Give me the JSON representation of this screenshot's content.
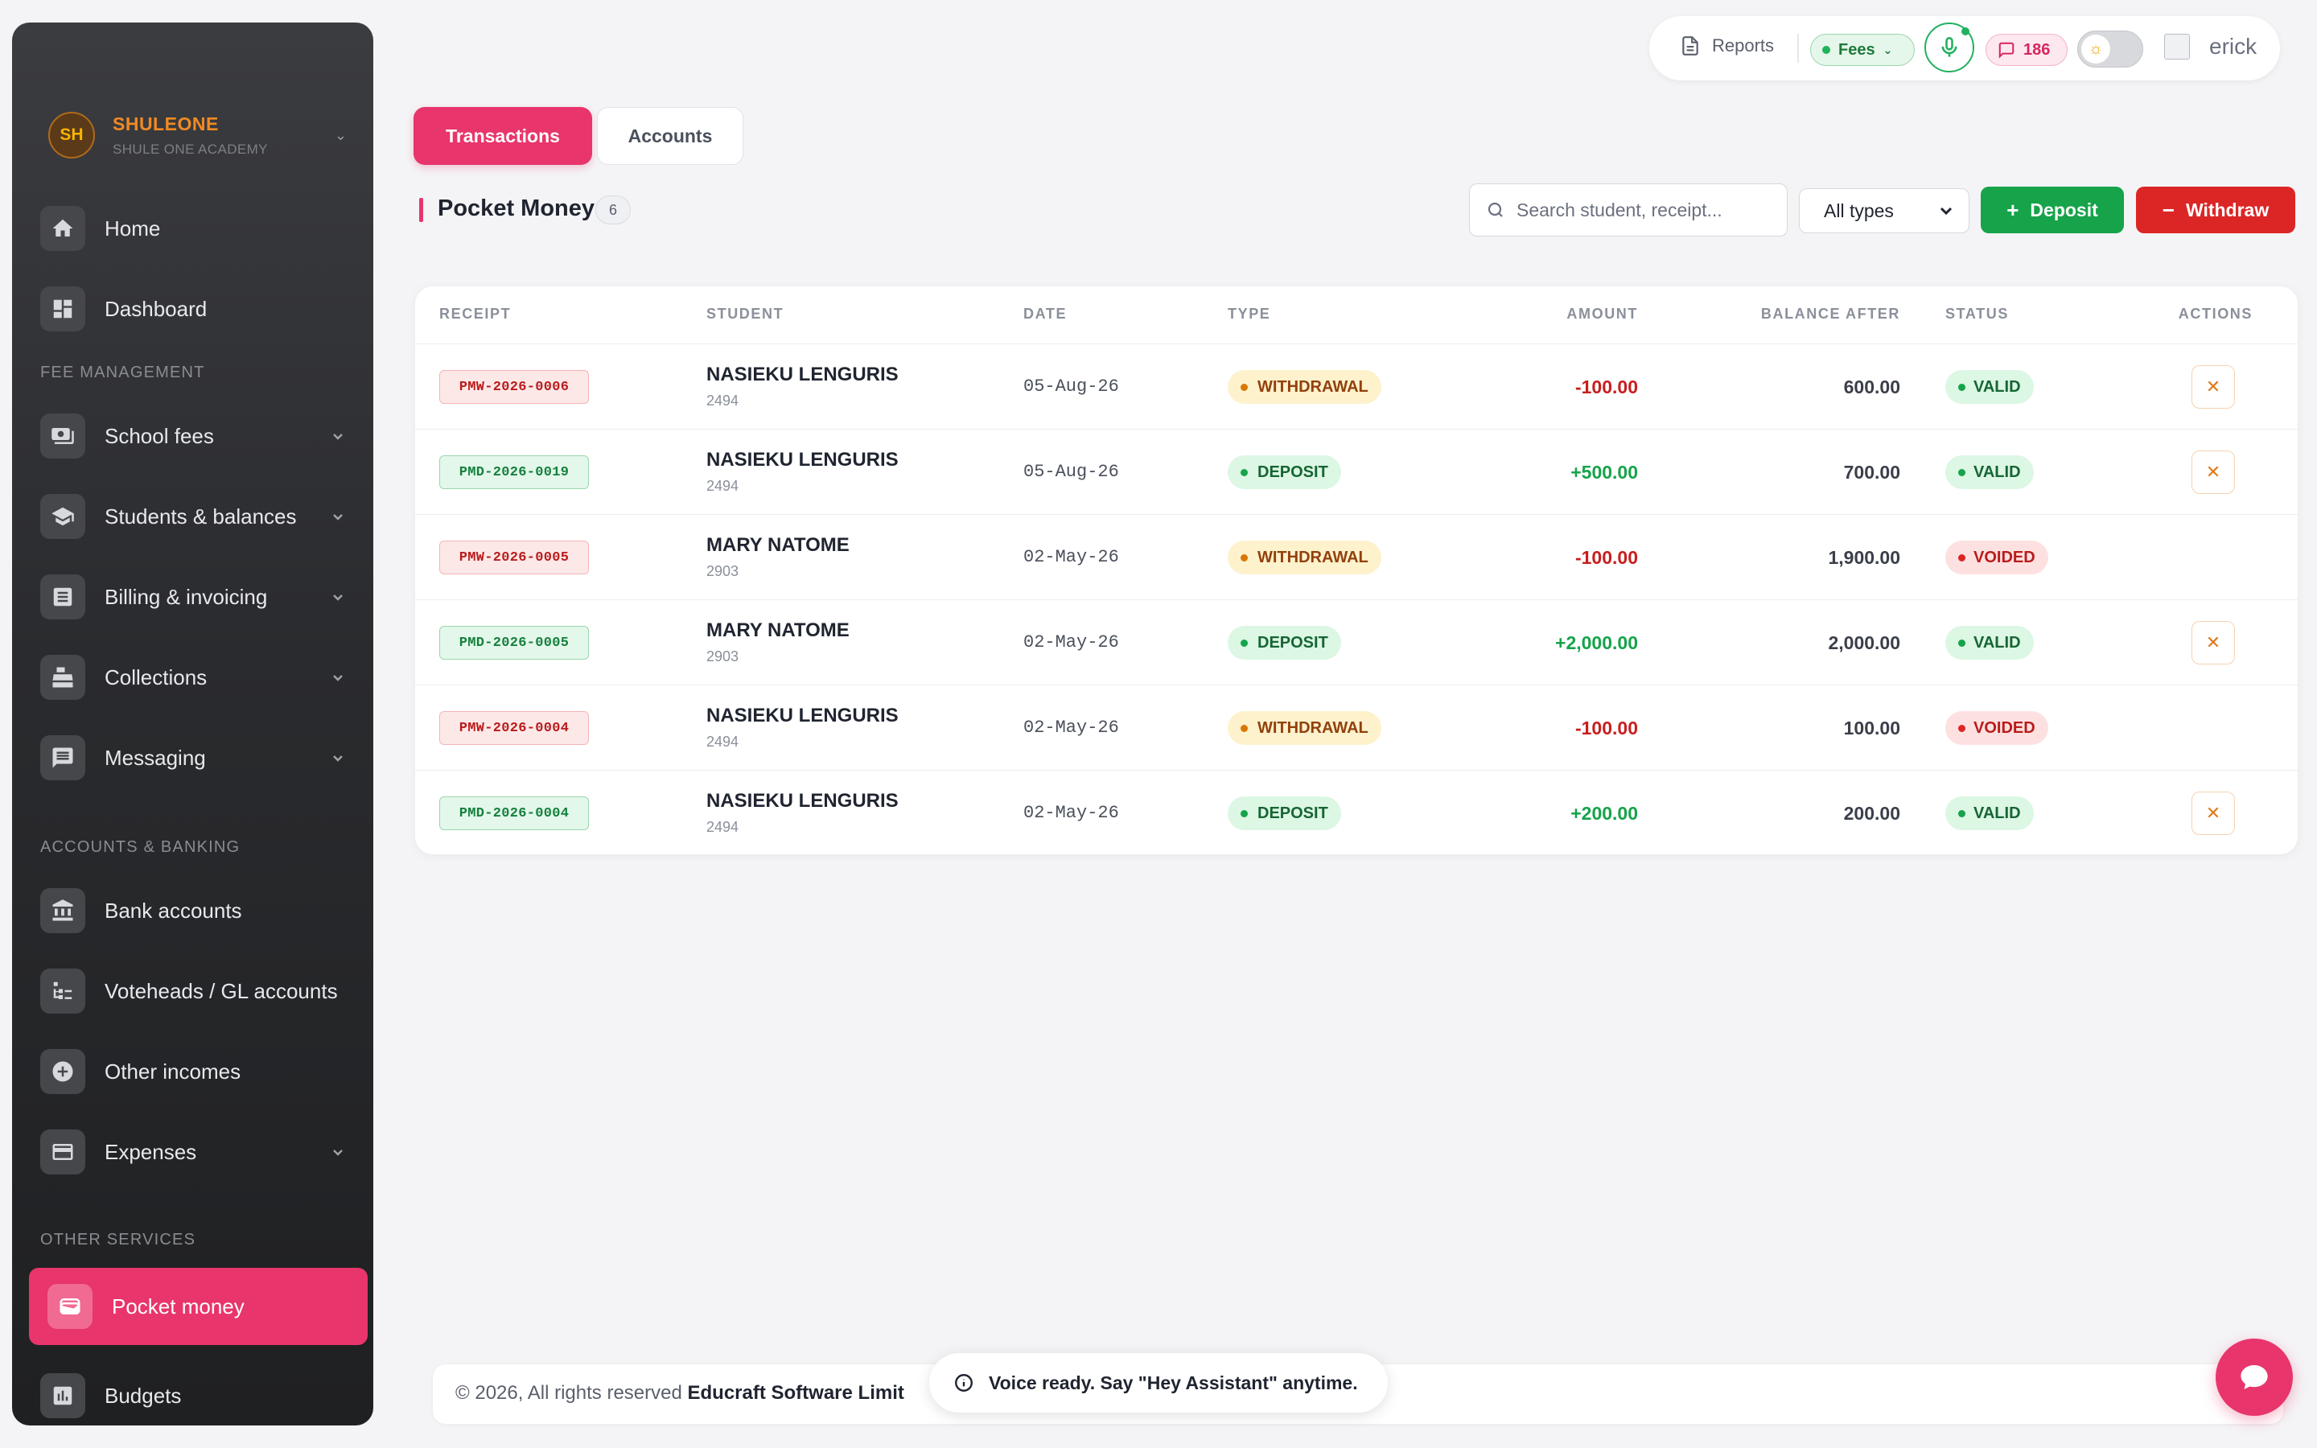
{
  "brand": {
    "initials": "SH",
    "name": "SHULEONE",
    "subtitle": "SHULE ONE ACADEMY"
  },
  "sidebar": {
    "items_top": [
      {
        "label": "Home",
        "icon": "home-icon"
      },
      {
        "label": "Dashboard",
        "icon": "dashboard-icon"
      }
    ],
    "sections": [
      {
        "title": "FEE MANAGEMENT"
      },
      {
        "title": "ACCOUNTS & BANKING"
      },
      {
        "title": "OTHER SERVICES"
      }
    ],
    "fee_items": [
      {
        "label": "School fees",
        "icon": "money-icon"
      },
      {
        "label": "Students & balances",
        "icon": "school-icon"
      },
      {
        "label": "Billing & invoicing",
        "icon": "invoice-icon"
      },
      {
        "label": "Collections",
        "icon": "register-icon"
      },
      {
        "label": "Messaging",
        "icon": "message-icon"
      }
    ],
    "bank_items": [
      {
        "label": "Bank accounts",
        "icon": "bank-icon"
      },
      {
        "label": "Voteheads / GL accounts",
        "icon": "tree-icon"
      },
      {
        "label": "Other incomes",
        "icon": "plus-circle-icon"
      },
      {
        "label": "Expenses",
        "icon": "card-icon"
      }
    ],
    "other_items": [
      {
        "label": "Pocket money",
        "icon": "wallet-icon",
        "active": true
      },
      {
        "label": "Budgets",
        "icon": "chart-icon"
      }
    ]
  },
  "topbar": {
    "reports": "Reports",
    "fees": "Fees",
    "messages_count": "186",
    "user": "erick"
  },
  "tabs": [
    {
      "label": "Transactions",
      "active": true
    },
    {
      "label": "Accounts",
      "active": false
    }
  ],
  "page": {
    "title": "Pocket Money",
    "count": "6",
    "search_placeholder": "Search student, receipt...",
    "type_filter": "All types",
    "deposit_label": "Deposit",
    "withdraw_label": "Withdraw"
  },
  "table": {
    "columns": [
      "RECEIPT",
      "STUDENT",
      "DATE",
      "TYPE",
      "AMOUNT",
      "BALANCE AFTER",
      "STATUS",
      "ACTIONS"
    ],
    "rows": [
      {
        "receipt": "PMW-2026-0006",
        "student": "NASIEKU LENGURIS",
        "student_id": "2494",
        "date": "05-Aug-26",
        "type": "WITHDRAWAL",
        "amount": "-100.00",
        "balance": "600.00",
        "status": "VALID"
      },
      {
        "receipt": "PMD-2026-0019",
        "student": "NASIEKU LENGURIS",
        "student_id": "2494",
        "date": "05-Aug-26",
        "type": "DEPOSIT",
        "amount": "+500.00",
        "balance": "700.00",
        "status": "VALID"
      },
      {
        "receipt": "PMW-2026-0005",
        "student": "MARY NATOME",
        "student_id": "2903",
        "date": "02-May-26",
        "type": "WITHDRAWAL",
        "amount": "-100.00",
        "balance": "1,900.00",
        "status": "VOIDED"
      },
      {
        "receipt": "PMD-2026-0005",
        "student": "MARY NATOME",
        "student_id": "2903",
        "date": "02-May-26",
        "type": "DEPOSIT",
        "amount": "+2,000.00",
        "balance": "2,000.00",
        "status": "VALID"
      },
      {
        "receipt": "PMW-2026-0004",
        "student": "NASIEKU LENGURIS",
        "student_id": "2494",
        "date": "02-May-26",
        "type": "WITHDRAWAL",
        "amount": "-100.00",
        "balance": "100.00",
        "status": "VOIDED"
      },
      {
        "receipt": "PMD-2026-0004",
        "student": "NASIEKU LENGURIS",
        "student_id": "2494",
        "date": "02-May-26",
        "type": "DEPOSIT",
        "amount": "+200.00",
        "balance": "200.00",
        "status": "VALID"
      }
    ]
  },
  "footer": {
    "copyright": "© 2026, All rights reserved",
    "company": "Educraft Software Limit"
  },
  "toast": "Voice ready. Say \"Hey Assistant\" anytime.",
  "colors": {
    "accent": "#e8356b",
    "deposit": "#16a34a",
    "withdraw": "#dc2626",
    "brand": "#f08a24"
  }
}
